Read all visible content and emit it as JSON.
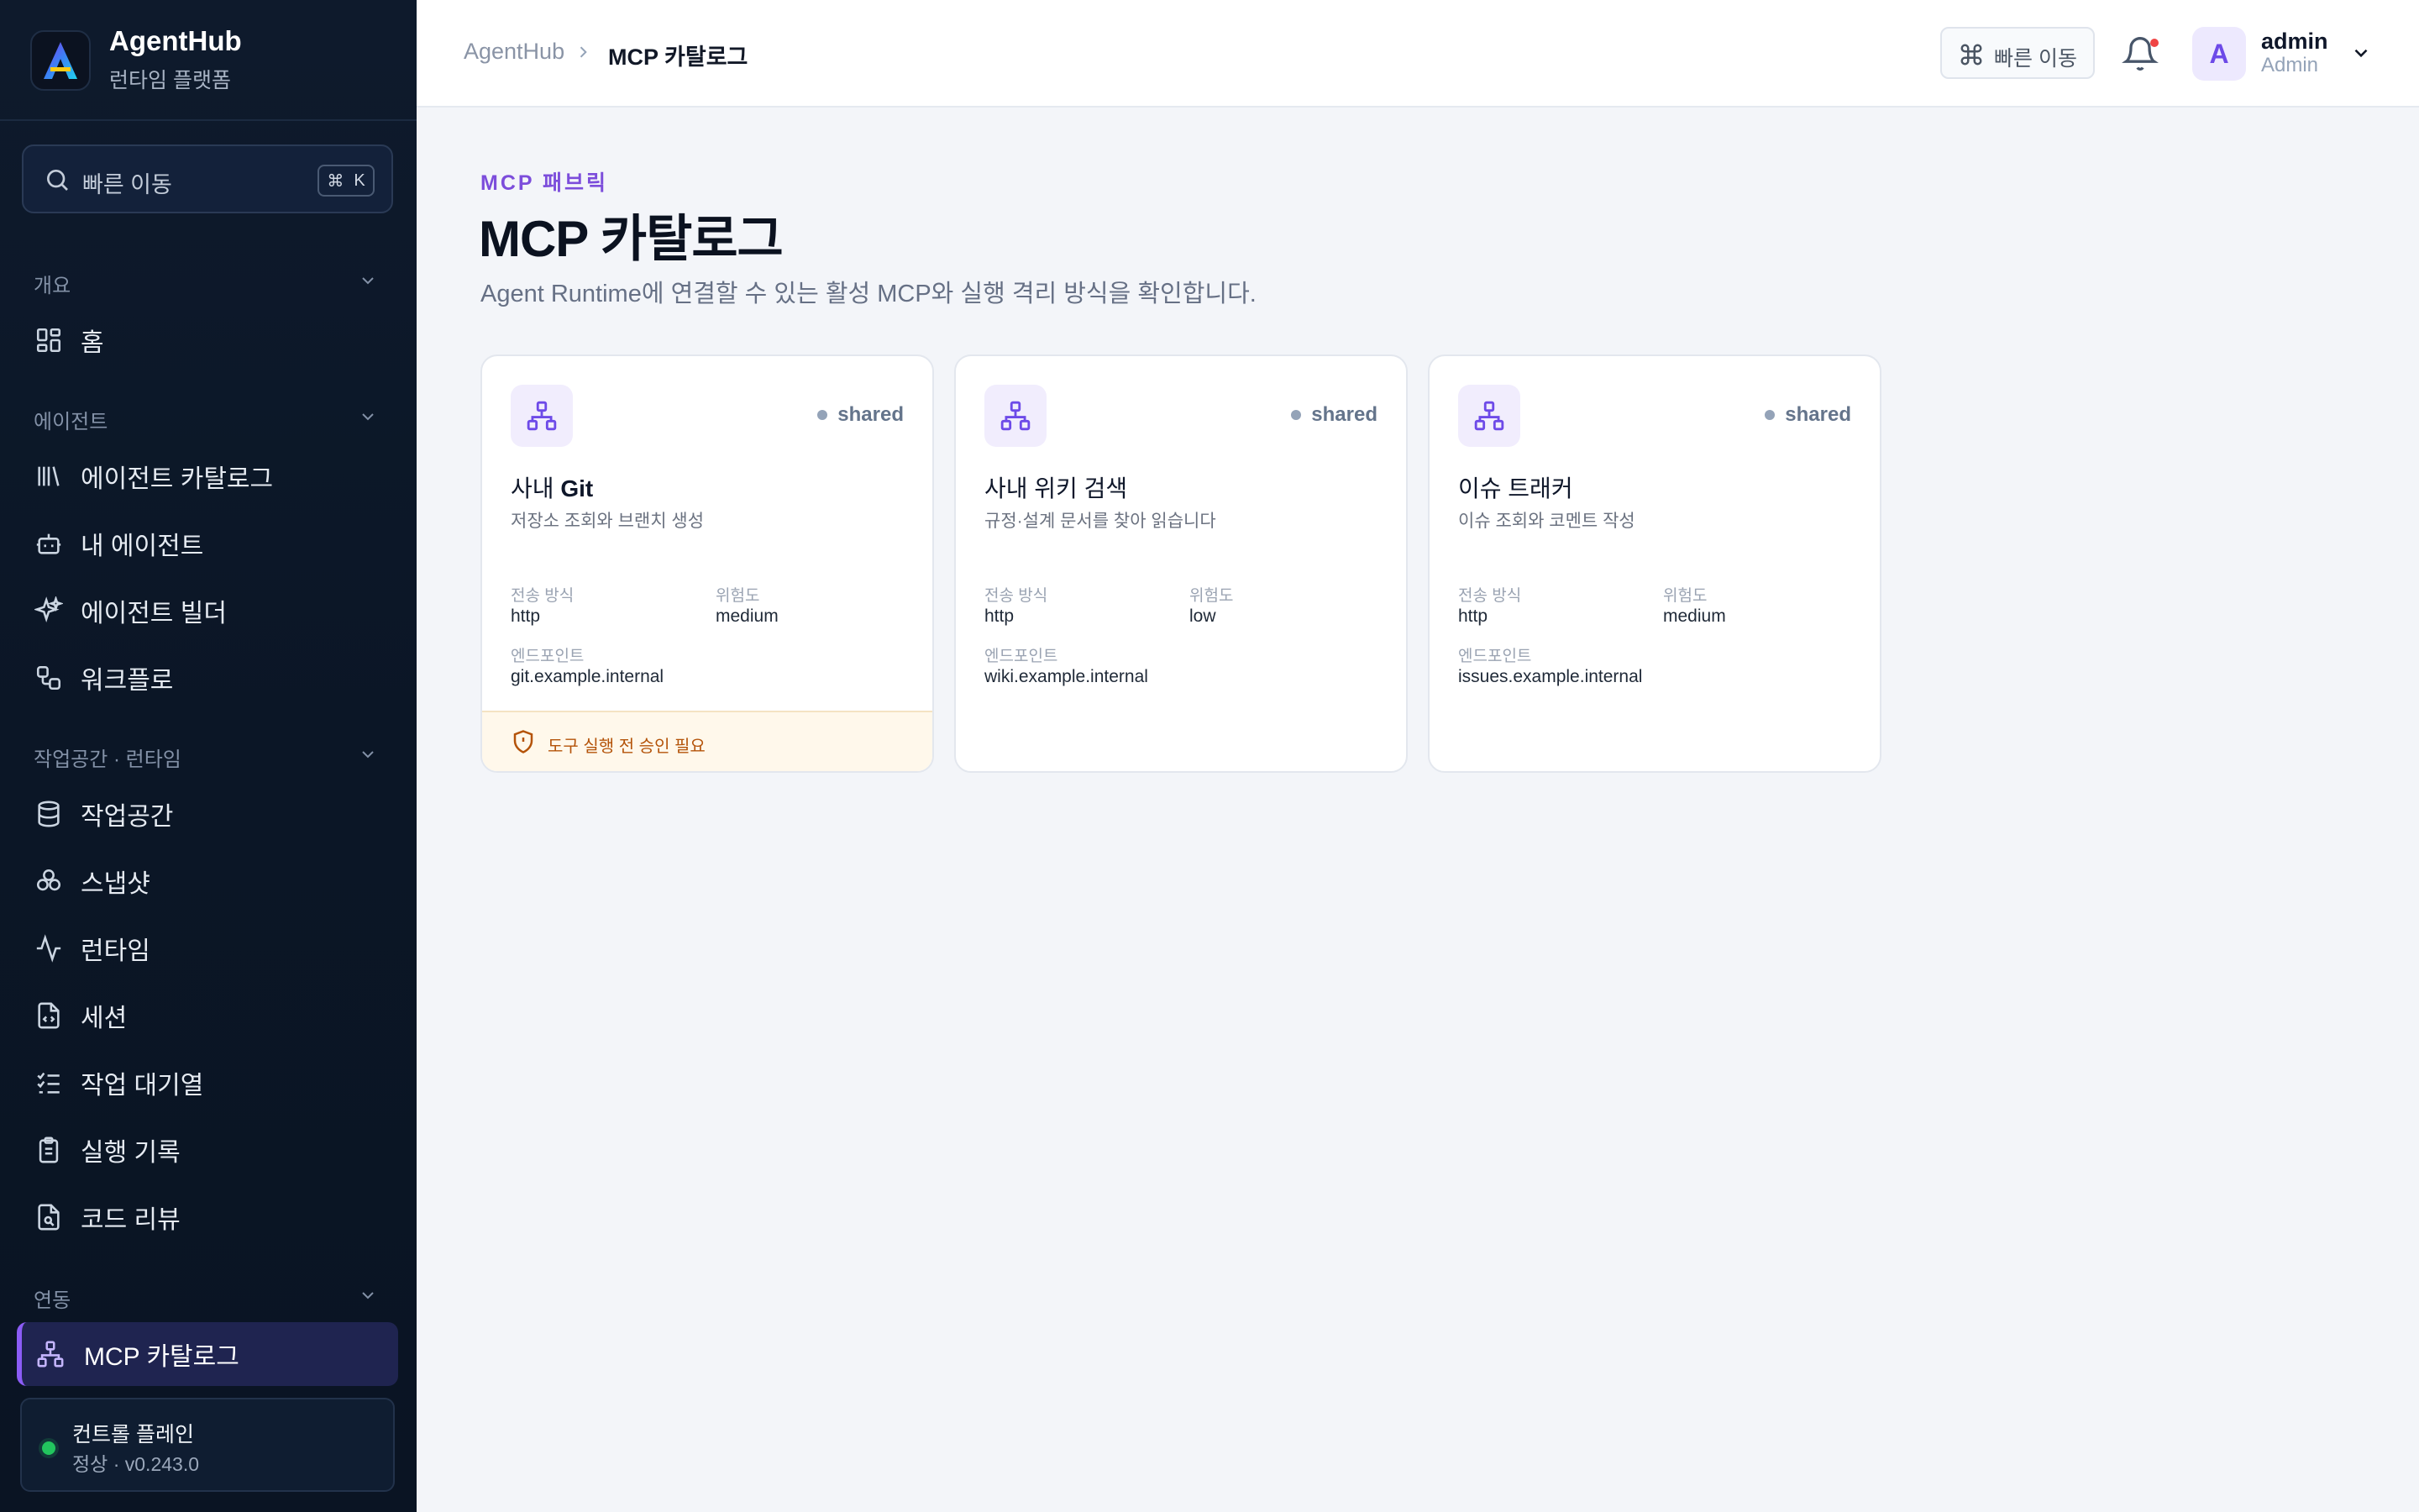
{
  "brand": {
    "name": "AgentHub",
    "subtitle": "런타임 플랫폼"
  },
  "sidebar": {
    "search_label": "빠른 이동",
    "search_shortcut_cmd": "⌘",
    "search_shortcut_key": "K",
    "sections": [
      {
        "label": "개요",
        "items": [
          {
            "label": "홈",
            "icon": "dashboard-grid-icon"
          }
        ]
      },
      {
        "label": "에이전트",
        "items": [
          {
            "label": "에이전트 카탈로그",
            "icon": "library-icon"
          },
          {
            "label": "내 에이전트",
            "icon": "robot-icon"
          },
          {
            "label": "에이전트 빌더",
            "icon": "sparkles-icon"
          },
          {
            "label": "워크플로",
            "icon": "workflow-icon"
          }
        ]
      },
      {
        "label": "작업공간 · 런타임",
        "items": [
          {
            "label": "작업공간",
            "icon": "database-icon"
          },
          {
            "label": "스냅샷",
            "icon": "snapshot-icon"
          },
          {
            "label": "런타임",
            "icon": "activity-icon"
          },
          {
            "label": "세션",
            "icon": "file-code-icon"
          },
          {
            "label": "작업 대기열",
            "icon": "list-checks-icon"
          },
          {
            "label": "실행 기록",
            "icon": "clipboard-icon"
          },
          {
            "label": "코드 리뷰",
            "icon": "file-search-icon"
          }
        ]
      },
      {
        "label": "연동",
        "items": [
          {
            "label": "MCP 카탈로그",
            "icon": "network-icon",
            "active": true
          }
        ]
      }
    ],
    "status": {
      "title": "컨트롤 플레인",
      "detail": "정상 · v0.243.0",
      "color": "#22c55e"
    }
  },
  "header": {
    "breadcrumb_root": "AgentHub",
    "breadcrumb_current": "MCP 카탈로그",
    "quick_label": "빠른 이동",
    "user": {
      "initial": "A",
      "name": "admin",
      "role": "Admin"
    }
  },
  "page": {
    "eyebrow": "MCP 패브릭",
    "title": "MCP 카탈로그",
    "description": "Agent Runtime에 연결할 수 있는 활성 MCP와 실행 격리 방식을 확인합니다."
  },
  "labels": {
    "transport": "전송 방식",
    "risk": "위험도",
    "endpoint": "엔드포인트"
  },
  "cards": [
    {
      "title_prefix": "사내 ",
      "title_bold": "Git",
      "description": "저장소 조회와 브랜치 생성",
      "scope": "shared",
      "transport": "http",
      "risk": "medium",
      "endpoint": "git.example.internal",
      "notice": "도구 실행 전 승인 필요"
    },
    {
      "title_prefix": "사내 위키 검색",
      "title_bold": "",
      "description": "규정·설계 문서를 찾아 읽습니다",
      "scope": "shared",
      "transport": "http",
      "risk": "low",
      "endpoint": "wiki.example.internal"
    },
    {
      "title_prefix": "이슈 트래커",
      "title_bold": "",
      "description": "이슈 조회와 코멘트 작성",
      "scope": "shared",
      "transport": "http",
      "risk": "medium",
      "endpoint": "issues.example.internal"
    }
  ],
  "colors": {
    "accent": "#8b5cf6",
    "sidebar_bg": "#0b1626",
    "warning": "#b45309"
  }
}
